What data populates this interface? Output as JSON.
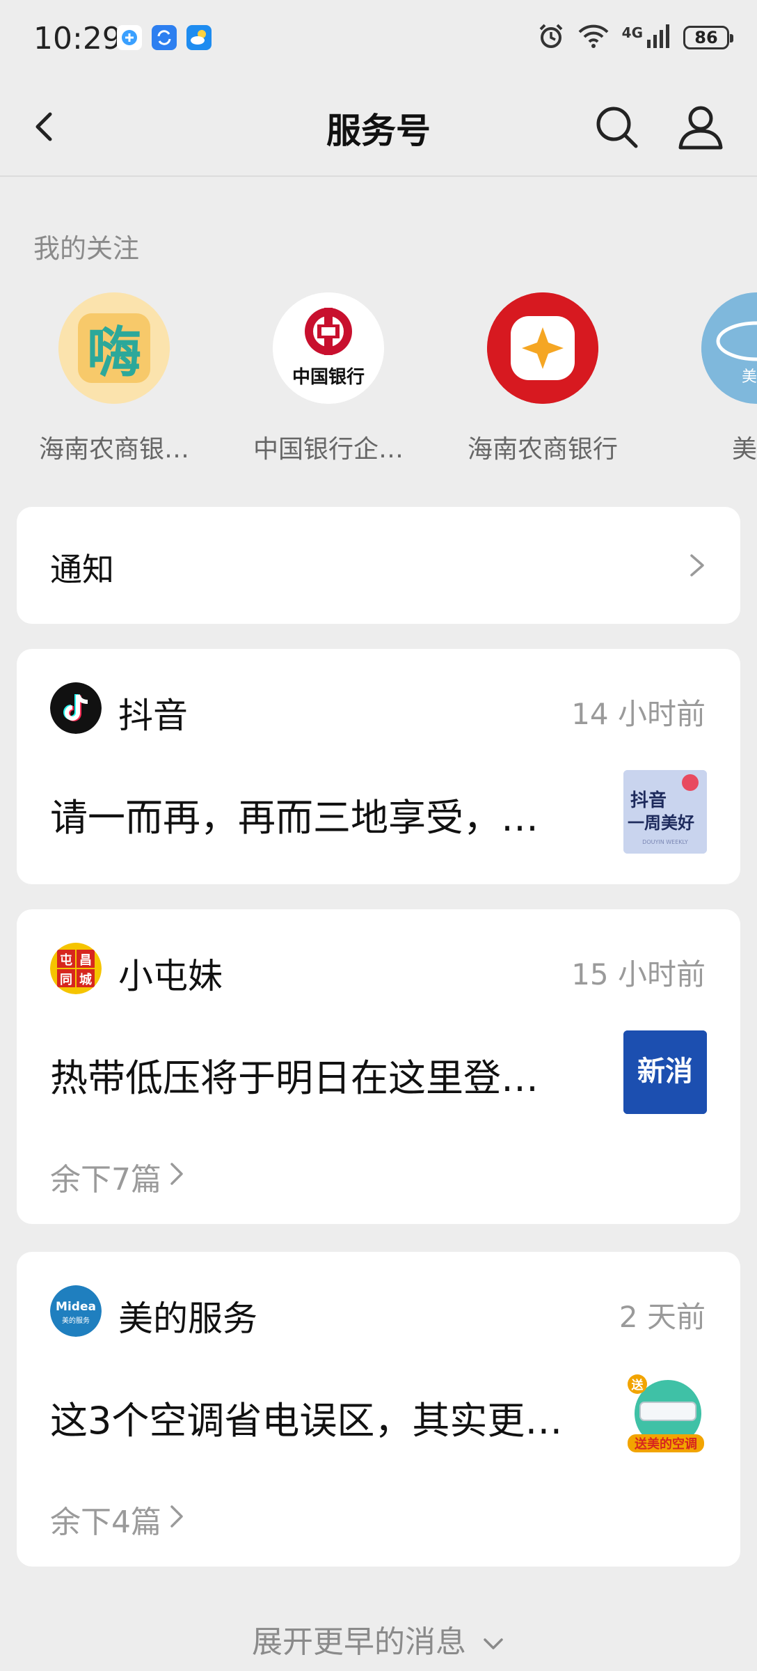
{
  "status_bar": {
    "time": "10:29",
    "network": "4G",
    "battery": "86",
    "icons": [
      "app-notification-icon",
      "sync-icon",
      "weather-icon",
      "alarm-icon",
      "wifi-icon",
      "signal-icon",
      "battery-icon"
    ]
  },
  "nav": {
    "title": "服务号",
    "icons": [
      "back-chevron-icon",
      "search-icon",
      "profile-icon"
    ]
  },
  "following": {
    "title": "我的关注",
    "items": [
      {
        "name": "海南农商银…",
        "logo_text": "嗨",
        "color": "#f7c96a"
      },
      {
        "name": "中国银行企…",
        "logo_text": "中国银行",
        "color": "#c8102e"
      },
      {
        "name": "海南农商银行",
        "color": "#d71920"
      },
      {
        "name": "美的",
        "logo_text": "美的",
        "color": "#7fb8dc"
      }
    ]
  },
  "notice": {
    "label": "通知"
  },
  "cards": [
    {
      "account": "抖音",
      "time": "14 小时前",
      "title": "请一而再，再而三地享受，…",
      "thumb_text_line1": "抖音",
      "thumb_text_line2": "一周美好",
      "thumb_caption": "DOUYIN WEEKLY"
    },
    {
      "account": "小屯妹",
      "time": "15 小时前",
      "title": "热带低压将于明日在这里登…",
      "avatar_chars": [
        "屯",
        "昌",
        "同",
        "城"
      ],
      "thumb_text": "新消",
      "more": "余下7篇"
    },
    {
      "account": "美的服务",
      "time": "2 天前",
      "title": "这3个空调省电误区，其实更…",
      "avatar_text": "Midea",
      "avatar_subtext": "美的服务",
      "thumb_badge": "送",
      "thumb_text": "送美的空调",
      "more": "余下4篇"
    }
  ],
  "footer": {
    "expand_label": "展开更早的消息"
  },
  "colors": {
    "background": "#ededed",
    "card": "#ffffff",
    "muted_text": "#9a9a9a",
    "boc_red": "#c8102e",
    "hainan_red": "#d71920",
    "midea_blue": "#1f7fbf"
  }
}
